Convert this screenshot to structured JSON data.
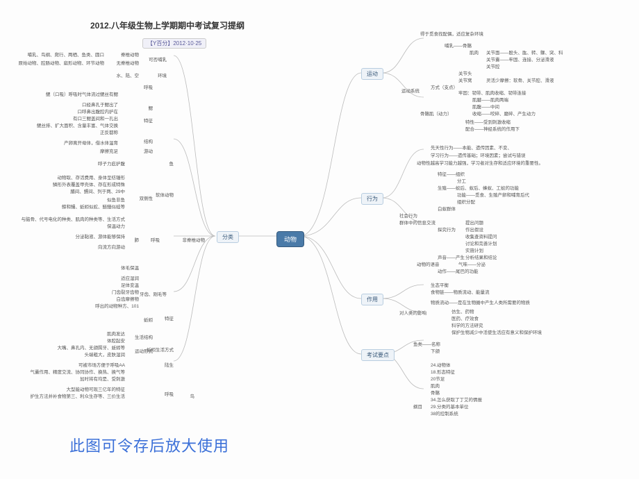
{
  "title": "2012.八年级生物上学期期中考试复习提纲",
  "subtitle": "【Y百分】2012·10·25",
  "root": "动物",
  "left_branch": "分类",
  "right_branches": {
    "r1": "运动",
    "r2": "行为",
    "r3": "作用",
    "r4": "考试要点"
  },
  "right_items": {
    "r1_a": "得于觅食找配偶，适应复杂环境",
    "r1_b1": "哺乳——骨骼",
    "r1_b2": "肌肉",
    "r1_b3": "关节面——股头、肱、转、髁、突、科",
    "r1_b4": "关节囊——牢固、连接、分泌滑液",
    "r1_b5": "关节腔",
    "r1_c1": "关节头",
    "r1_c2": "关节窝",
    "r1_c3": "灵活少摩擦：软骨、关节腔、滑液",
    "r1_c4": "牢固：韧带、肌肉收缩、韧带连接",
    "r1_c5": "肌腱——肌肉两端",
    "r1_c6": "肌腹——中间",
    "r1_c7": "收缩——咬碎、磨碎、产生动力",
    "r1_d1": "运动系统",
    "r1_d2": "方式（支点）",
    "r1_d3": "骨骼肌（动力）",
    "r1_d4": "特性——受到刺激收缩",
    "r1_d5": "配合——神经系统的作用下",
    "r2_a1": "先天性行为——本能、遗传因素、不变、",
    "r2_a2": "学习行为——遗传基础；环境因素；尝试与错误",
    "r2_a3": "动物性越高学习能力越强，学习者对生存和适应环境的重要性。",
    "r2_b1": "特征——组织",
    "r2_b2": "分工",
    "r2_b3": "生殖——蚁后、蚁后、蜂蚁、工蚁的功能",
    "r2_b4": "功能——觅食、生殖产卵和哺育后代",
    "r2_b5": "组织分配",
    "r2_b6": "白蚁群体",
    "r2_b7": "社会行为",
    "r2_b8": "群体中的信息交流",
    "r2_b9": "提出问题",
    "r2_b10": "探究行为",
    "r2_b11": "作出假设",
    "r2_b12": "收集查资料提问",
    "r2_b13": "讨论和完善计划",
    "r2_b14": "实施计划",
    "r2_b15": "分析结果和结论",
    "r2_b16": "声音——产生",
    "r2_b17": "动物的语音",
    "r2_b18": "气味——分泌",
    "r2_b19": "动作——尾巴的功能",
    "r3_a1": "生态平衡",
    "r3_a2": "食物链——物质流动、能量流",
    "r3_a3": "物质流动——是在生物圈中产生人类所需要的物质",
    "r3_a4": "对人类的影响",
    "r3_a5": "仿生、药物",
    "r3_a6": "医药、疗效食",
    "r3_a7": "科学的方法研究",
    "r3_a8": "保护生物减少中活使生活应有意义和保护环境",
    "r4_a1": "鱼类——名称",
    "r4_a2": "下颌",
    "r4_a3": "24.动物体",
    "r4_a4": "18.形态特征",
    "r4_a5": "20节足",
    "r4_a6": "肌肉",
    "r4_a7": "骨骼",
    "r4_a8": "34.怎么获取了丁艾的情报",
    "r4_a9": "29.分类的基本单位",
    "r4_a10": "38的控制系统",
    "r4_a11": "纲目"
  },
  "left_items": {
    "l1_a": "脊椎动物",
    "l1_b": "无脊椎动物",
    "l1_c": "哺乳、鸟纲、爬行、两栖、鱼类、圆口",
    "l1_d": "原始动物、腔肠动物、扁形动物、环节动物",
    "l1_e": "可否哺乳",
    "l2_a": "环境",
    "l2_b": "水、陆、空",
    "l2_c": "呼吸",
    "l2_d": "鳃（口吸）呼吸时气体流过鳃丝有鳃",
    "l2_e": "口经鼻孔于鳃出了",
    "l2_f": "口呼鼻出腹腔内护在",
    "l2_g": "有口三鳃盖间和一孔出",
    "l2_h": "鳃丝排、扩大面积、含量丰富、气体交换",
    "l2_i": "正反都称",
    "l2_j": "产卵离开母体，借水体温育",
    "l2_k": "摩擦充足",
    "l2_l": "游动",
    "l2_m": "呼子力庇护腹",
    "l3_a": "鳃",
    "l3_b": "特征",
    "l3_c": "结构",
    "l3_d": "鱼",
    "l3_e": "动物取、存活费用、身体呈纺锤形",
    "l3_f": "鳞形外表覆盖甲壳体、存在形成特殊",
    "l3_g": "脯间、鳔间、列于两、29中",
    "l3_h": "似鱼非鱼",
    "l3_i": "鲸和鳗、蚯蚓似蛇、鲢鳝似蛙等",
    "l3_j": "双侧性",
    "l3_k": "与脑骨、代号电化的种类、肌肉的种类等、生活方式",
    "l3_l": "保温动力",
    "l3_m": "分泌黏液、游体能够保持",
    "l3_n": "向流方向游动",
    "l4_a": "软体动物",
    "l4_b": "呼吸",
    "l4_c": "肺",
    "l4_d": "非脊椎动物",
    "l4_e": "适应湿润",
    "l4_f": "体毛保温",
    "l4_g": "足体变温",
    "l4_h": "门齿裂牙齿物",
    "l4_i": "白齿摩擦物",
    "l4_j": "呼出的动物种方、101",
    "l5_a": "蚯蚓",
    "l5_b": "牙齿、刚毛等",
    "l5_c": "特征",
    "l5_d": "肌肉发达",
    "l5_e": "体腔起安",
    "l5_f": "大嘴、鼻孔内、无颌腭牙、蚯蚓等",
    "l5_g": "生活结构",
    "l5_h": "头端粗大，皮肤湿润",
    "l5_i": "运动形式",
    "l5_j": "蚯蚓生活方式",
    "l5_k": "可被市场方便于呼吸AA",
    "l5_l": "气囊作用、精度交流、协同协作、换热、换气等",
    "l5_m": "加时将有均是、受刺激",
    "l5_n": "大型能动物可现三亿年的特征",
    "l5_o": "护生方法并补食物第三、利众生存等、三价生活",
    "l5_p": "呼吸",
    "l5_q": "陆生",
    "l5_r": "鸟"
  },
  "footer": "此图可令存后放大使用"
}
